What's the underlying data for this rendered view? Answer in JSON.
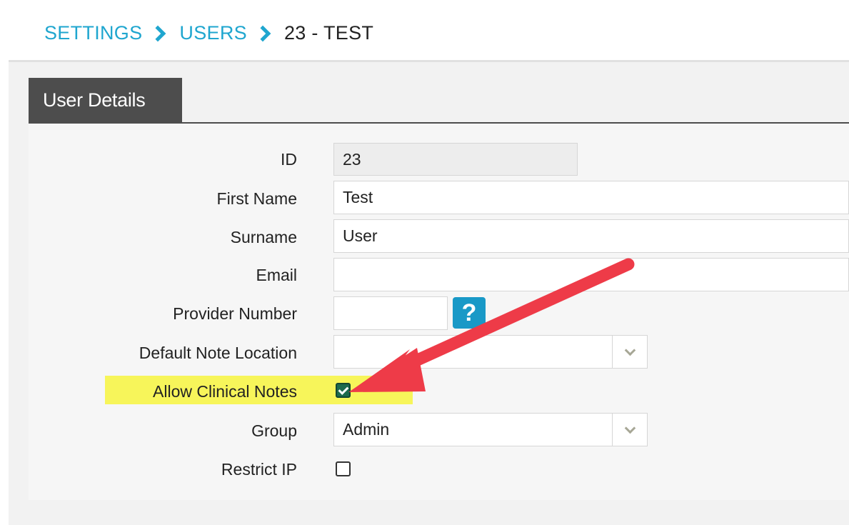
{
  "breadcrumb": {
    "settings": "SETTINGS",
    "users": "USERS",
    "current": "23 - TEST"
  },
  "tab": {
    "label": "User Details"
  },
  "form": {
    "id": {
      "label": "ID",
      "value": "23"
    },
    "first_name": {
      "label": "First Name",
      "value": "Test"
    },
    "surname": {
      "label": "Surname",
      "value": "User"
    },
    "email": {
      "label": "Email",
      "value": ""
    },
    "provider_number": {
      "label": "Provider Number",
      "value": "",
      "help": "?"
    },
    "default_note_location": {
      "label": "Default Note Location",
      "value": ""
    },
    "allow_clinical_notes": {
      "label": "Allow Clinical Notes",
      "checked": true
    },
    "group": {
      "label": "Group",
      "value": "Admin"
    },
    "restrict_ip": {
      "label": "Restrict IP",
      "checked": false
    }
  },
  "colors": {
    "breadcrumb_link": "#1fa6cf",
    "tab_bg": "#4d4d4d",
    "highlight": "#f7f55a",
    "annotation_arrow": "#ee3b48",
    "help_button": "#1999c7",
    "checkbox_checked": "#1d6b4d"
  },
  "icons": {
    "breadcrumb_separator": "chevron-right-icon",
    "select_button": "chevron-down-icon",
    "annotation": "arrow-annotation-icon"
  }
}
